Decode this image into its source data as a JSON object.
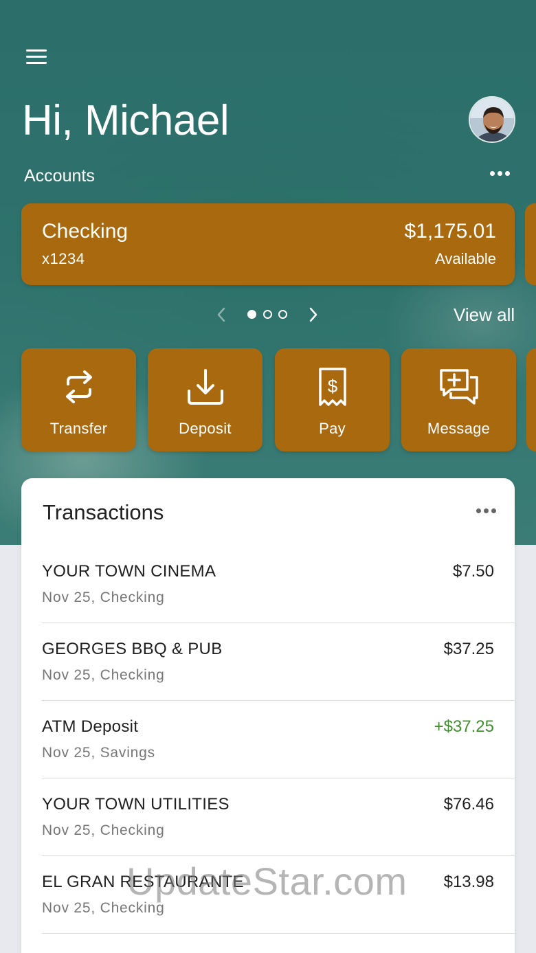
{
  "header": {
    "greeting": "Hi, Michael",
    "accounts_label": "Accounts"
  },
  "account_card": {
    "name": "Checking",
    "number": "x1234",
    "balance": "$1,175.01",
    "balance_label": "Available"
  },
  "carousel": {
    "pages": 3,
    "active_page": 1,
    "view_all_label": "View all"
  },
  "actions": [
    {
      "label": "Transfer",
      "icon": "transfer-arrows-icon"
    },
    {
      "label": "Deposit",
      "icon": "deposit-download-icon"
    },
    {
      "label": "Pay",
      "icon": "pay-bill-icon"
    },
    {
      "label": "Message",
      "icon": "message-add-icon"
    }
  ],
  "transactions": {
    "title": "Transactions",
    "items": [
      {
        "merchant": "YOUR TOWN CINEMA",
        "meta": "Nov 25, Checking",
        "amount": "$7.50",
        "type": "debit"
      },
      {
        "merchant": "GEORGES BBQ & PUB",
        "meta": "Nov 25, Checking",
        "amount": "$37.25",
        "type": "debit"
      },
      {
        "merchant": "ATM Deposit",
        "meta": "Nov 25, Savings",
        "amount": "+$37.25",
        "type": "credit"
      },
      {
        "merchant": "YOUR TOWN UTILITIES",
        "meta": "Nov 25, Checking",
        "amount": "$76.46",
        "type": "debit"
      },
      {
        "merchant": "EL GRAN RESTAURANTE",
        "meta": "Nov 25, Checking",
        "amount": "$13.98",
        "type": "debit"
      }
    ]
  },
  "colors": {
    "accent": "#a8690f",
    "credit": "#3f8f2c",
    "hero": "#2f726d"
  },
  "watermark": "UpdateStar.com"
}
